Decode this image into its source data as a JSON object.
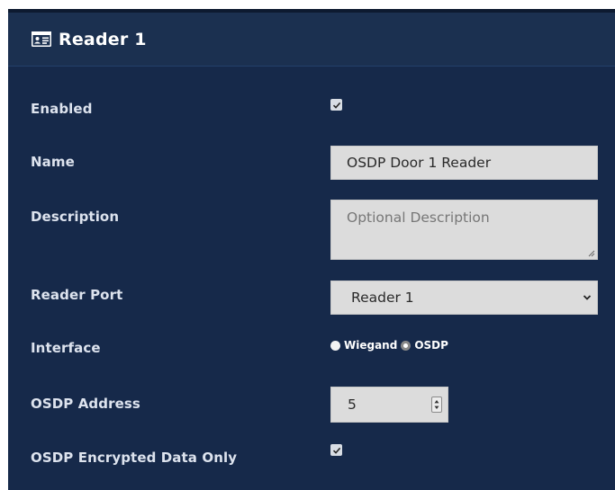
{
  "panel": {
    "title": "Reader 1",
    "icon": "id-card-icon"
  },
  "form": {
    "enabled": {
      "label": "Enabled",
      "checked": true
    },
    "name": {
      "label": "Name",
      "value": "OSDP Door 1 Reader"
    },
    "description": {
      "label": "Description",
      "value": "",
      "placeholder": "Optional Description"
    },
    "reader_port": {
      "label": "Reader Port",
      "selected": "Reader 1"
    },
    "interface": {
      "label": "Interface",
      "options": [
        {
          "label": "Wiegand",
          "selected": false
        },
        {
          "label": "OSDP",
          "selected": true
        }
      ]
    },
    "osdp_address": {
      "label": "OSDP Address",
      "value": "5"
    },
    "osdp_encrypted": {
      "label": "OSDP Encrypted Data Only",
      "checked": true
    }
  },
  "colors": {
    "panel_bg": "#16294a",
    "header_bg": "#1b3050",
    "input_bg": "#dcdcdc"
  }
}
